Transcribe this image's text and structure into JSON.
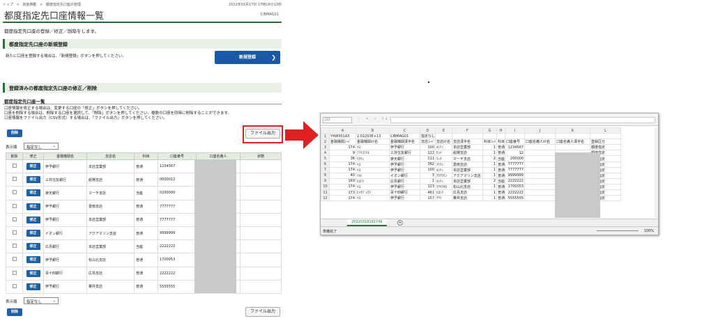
{
  "breadcrumb": [
    "トップ",
    ">",
    "資金移動",
    ">",
    "都度指定先口座の管理"
  ],
  "datetime": "2022年03月17日 17時16分13秒",
  "page_title": "都度指定先口座情報一覧",
  "screen_id": "CIBMAG01",
  "description": "都度指定先口座の登録／修正／削除をします。",
  "new_section": {
    "title": "都度指定先口座の新規登録",
    "note": "新たに口座を登録する場合は、「新規登録」ボタンを押してください。",
    "button": "新規登録",
    "arrow": "❯"
  },
  "edit_section": {
    "title": "登録済みの都度指定先口座の修正／削除",
    "subtitle": "都度指定先口座一覧",
    "notes": [
      "口座情報を修正する場合は、変更する口座の「修正」ボタンを押してください。",
      "口座を削除する場合は、削除する口座を選択して、「削除」ボタンを押してください。複数の口座を同時に削除することができます。",
      "口座情報をファイル出力（CSV形式）する場合は、「ファイル出力」ボタンを押してください。"
    ],
    "delete_button": "削除",
    "file_button": "ファイル出力",
    "display_label": "表示順",
    "display_value": "指定なし",
    "caret": "⌄",
    "headers": [
      "削除",
      "修正",
      "金融機関名",
      "支店名",
      "科目",
      "口座番号",
      "口座名義人",
      "状態"
    ],
    "edit_label": "修正",
    "rows": [
      {
        "bank": "伊予銀行",
        "branch": "本店営業部",
        "type": "普通",
        "acct": "1234567"
      },
      {
        "bank": "三井住友銀行",
        "branch": "船場支店",
        "type": "普通",
        "acct": "0000012"
      },
      {
        "bank": "楽天銀行",
        "branch": "マーチ支店",
        "type": "当座",
        "acct": "0200000"
      },
      {
        "bank": "伊予銀行",
        "branch": "愛南支店",
        "type": "普通",
        "acct": "7777777"
      },
      {
        "bank": "伊予銀行",
        "branch": "本店営業部",
        "type": "普通",
        "acct": "7777777"
      },
      {
        "bank": "イオン銀行",
        "branch": "アクアマリン支店",
        "type": "普通",
        "acct": "9999999"
      },
      {
        "bank": "広島銀行",
        "branch": "本店営業部",
        "type": "当座",
        "acct": "2222222"
      },
      {
        "bank": "伊予銀行",
        "branch": "松山北支店",
        "type": "普通",
        "acct": "1700053"
      },
      {
        "bank": "百十四銀行",
        "branch": "広島支店",
        "type": "普通",
        "acct": "2222222"
      },
      {
        "bank": "伊予銀行",
        "branch": "粟井支店",
        "type": "普通",
        "acct": "5555555"
      }
    ]
  },
  "excel": {
    "name_box": "J22",
    "fx_symbols": "⋮ ✕ ✓ fx",
    "columns": [
      "A",
      "B",
      "C",
      "D",
      "E",
      "F",
      "G",
      "H",
      "I",
      "J",
      "K",
      "L"
    ],
    "row1": [
      "Y4W301A3",
      "2.02203E+13",
      "CIBMAG01",
      "指定なし",
      "",
      "",
      "",
      "",
      "",
      "",
      "",
      ""
    ],
    "row2": [
      "金融機関ｺｰﾄﾞ",
      "金融機関ｶﾅ名",
      "金融機関漢字名",
      "支店ｺｰﾄﾞ",
      "支店ｶﾅ名",
      "支店漢字名",
      "科目ｺｰﾄﾞ",
      "科目",
      "口座番号",
      "口座名義人ｶﾅ名",
      "口座名義人漢字名",
      "登録区分"
    ],
    "rows": [
      [
        "174",
        "ｲﾖ",
        "伊予銀行",
        "100",
        "ﾎﾝﾃﾝ",
        "本店営業部",
        "1",
        "普通",
        "1234567",
        "",
        "",
        "都度指定"
      ],
      [
        "9",
        "ﾐﾂｲｽﾐﾄﾓ",
        "三井住友銀行",
        "122",
        "ｾﾝﾊﾞ",
        "船場支店",
        "1",
        "普通",
        "12",
        "",
        "",
        "都度指定"
      ],
      [
        "36",
        "ﾗｸﾃﾝ",
        "楽天銀行",
        "211",
        "ﾏｰﾁ",
        "マーチ支店",
        "2",
        "当座",
        "200000",
        "",
        "",
        "都度指定"
      ],
      [
        "174",
        "ｲﾖ",
        "伊予銀行",
        "362",
        "ｱｲﾅﾝ",
        "愛南支店",
        "1",
        "普通",
        "7777777",
        "",
        "",
        "都度指定"
      ],
      [
        "174",
        "ｲﾖ",
        "伊予銀行",
        "100",
        "ﾎﾝﾃﾝ",
        "本店営業部",
        "1",
        "普通",
        "7777777",
        "",
        "",
        "都度指定"
      ],
      [
        "40",
        "ｲｵﾝ",
        "イオン銀行",
        "3",
        "ｱｸｱﾏﾘﾝ",
        "アクアマリン支店",
        "1",
        "普通",
        "9999999",
        "",
        "",
        "都度指定"
      ],
      [
        "169",
        "ﾋﾛｼﾏ",
        "広島銀行",
        "1",
        "ﾎﾝﾃﾝ",
        "本店営業部",
        "2",
        "当座",
        "2222222",
        "",
        "",
        "都度指定"
      ],
      [
        "174",
        "ｲﾖ",
        "伊予銀行",
        "123",
        "ﾏﾂﾔﾏｷﾀ",
        "松山北支店",
        "1",
        "普通",
        "1700053",
        "",
        "",
        "都度指定"
      ],
      [
        "173",
        "ﾋｬｸｼﾞｭｳｼ",
        "百十四銀行",
        "461",
        "ﾋﾛｼﾏ",
        "広島支店",
        "1",
        "普通",
        "2222222",
        "",
        "",
        "都度指定"
      ],
      [
        "174",
        "ｲﾖ",
        "伊予銀行",
        "157",
        "ｱﾜｲ",
        "粟井支店",
        "1",
        "普通",
        "5555555",
        "",
        "",
        "都度指定"
      ]
    ],
    "sheet_tab": "20220318191746",
    "plus": "+",
    "status": "準備完了",
    "zoom": "100%"
  },
  "colors": {
    "green": "#2f6e3a",
    "blue": "#1f5fa8",
    "red": "#e02020",
    "excel_green": "#1b7a3a"
  }
}
